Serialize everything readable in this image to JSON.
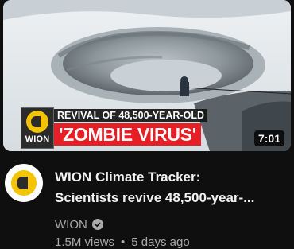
{
  "video": {
    "thumbnail": {
      "overlay_line1": "REVIVAL OF 48,500-YEAR-OLD",
      "overlay_line2": "'ZOMBIE VIRUS'",
      "logo_text": "WION",
      "duration": "7:01"
    },
    "title_line1": "WION Climate Tracker:",
    "title_line2": "Scientists revive 48,500-year-...",
    "channel": "WION",
    "views": "1.5M views",
    "age": "5 days ago"
  },
  "colors": {
    "background": "#0f0f0f",
    "headline_red": "#e61e25",
    "wion_yellow": "#f4c400",
    "secondary_text": "#aaaaaa"
  },
  "icons": [
    "wion-logo-icon",
    "verified-badge-icon"
  ]
}
